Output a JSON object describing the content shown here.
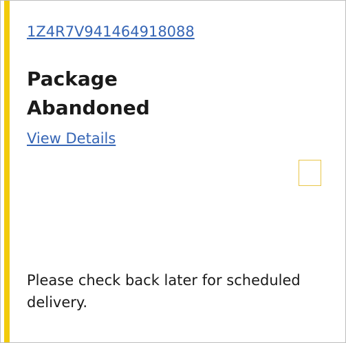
{
  "card": {
    "tracking_number": "1Z4R7V941464918088",
    "status_title": "Package Abandoned",
    "details_link_label": "View Details",
    "message": "Please check back later for scheduled delivery."
  },
  "colors": {
    "accent": "#f2cb0b",
    "link": "#3565b5",
    "border": "#bdbdbd"
  }
}
